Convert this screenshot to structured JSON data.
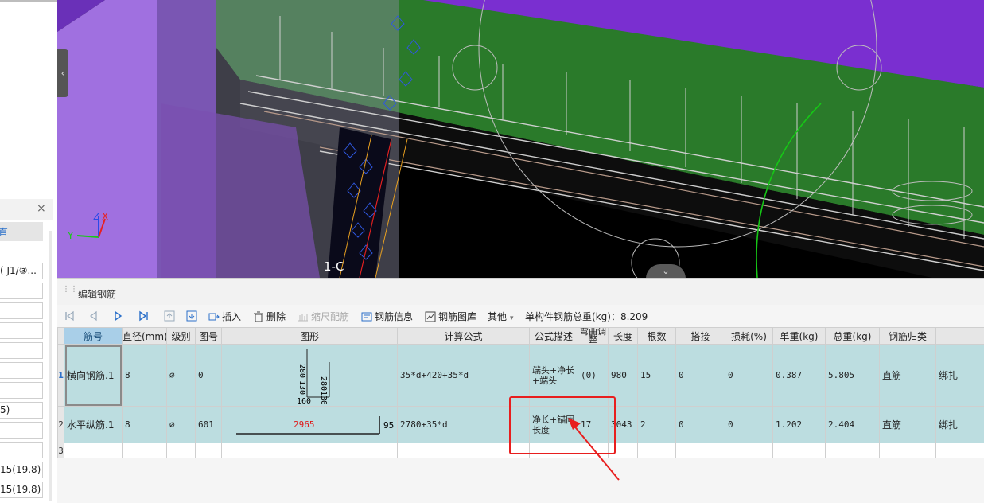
{
  "left_panel": {
    "fields": [
      "( J1/③...",
      "",
      "",
      "",
      "",
      "",
      "5)",
      "",
      "",
      "15(19.8)",
      "15(19.8)"
    ],
    "tab_label": "直",
    "close_glyph": "×"
  },
  "viewport": {
    "axis_label": "1-C",
    "axes": {
      "x": "X",
      "y": "Y",
      "z": "Z"
    },
    "collapse_glyph": "‹",
    "bottom_glyph": "⌄"
  },
  "editor": {
    "title": "编辑钢筋",
    "toolbar": {
      "insert": "插入",
      "delete": "删除",
      "scale_rebar": "缩尺配筋",
      "rebar_info": "钢筋信息",
      "rebar_library": "钢筋图库",
      "other": "其他",
      "total_weight_label": "单构件钢筋总重(kg)：",
      "total_weight_value": "8.209"
    },
    "columns": [
      "筋号",
      "直径(mm)",
      "级别",
      "图号",
      "图形",
      "计算公式",
      "公式描述",
      "弯曲调整",
      "长度",
      "根数",
      "搭接",
      "损耗(%)",
      "单重(kg)",
      "总重(kg)",
      "钢筋归类",
      ""
    ],
    "rows": [
      {
        "num": "1",
        "name": "横向钢筋.1",
        "diameter": "8",
        "grade": "⌀",
        "figure_no": "0",
        "shape_labels": {
          "a": "280",
          "b": "130",
          "c": "280",
          "d": "130",
          "e": "160"
        },
        "formula": "35*d+420+35*d",
        "description": "端头+净长+端头",
        "bend": "(0)",
        "length": "980",
        "count": "15",
        "lap": "0",
        "loss": "0",
        "unit_weight": "0.387",
        "total_weight": "5.805",
        "category": "直筋",
        "binding": "绑扎"
      },
      {
        "num": "2",
        "name": "水平纵筋.1",
        "diameter": "8",
        "grade": "⌀",
        "figure_no": "601",
        "shape_labels": {
          "main": "2965",
          "hook": "95"
        },
        "formula": "2780+35*d",
        "description": "净长+锚固长度",
        "bend": "17",
        "length": "3043",
        "count": "2",
        "lap": "0",
        "loss": "0",
        "unit_weight": "1.202",
        "total_weight": "2.404",
        "category": "直筋",
        "binding": "绑扎"
      },
      {
        "num": "3"
      }
    ]
  },
  "colors": {
    "purple": "#7a2fd0",
    "green": "#1f6f1f",
    "header_blue": "#a9cfe8",
    "row_teal": "#bcdde0",
    "annotation_red": "#e81e1e"
  }
}
